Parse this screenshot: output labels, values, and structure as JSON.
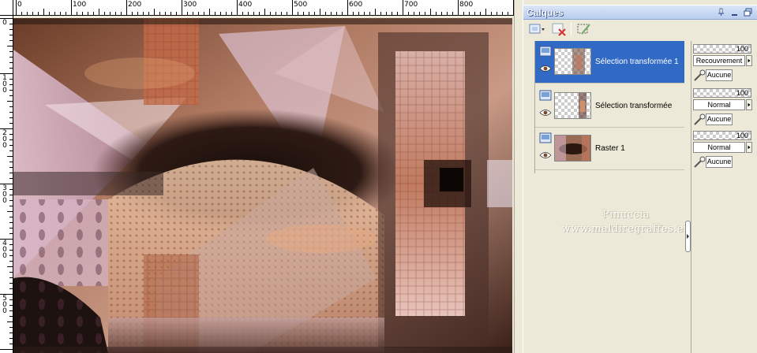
{
  "rulers": {
    "horizontal_labels": [
      "0",
      "100",
      "200",
      "300",
      "400",
      "500",
      "600",
      "700",
      "800"
    ],
    "vertical_labels": [
      "0",
      "1\n0\n0",
      "2\n0\n0",
      "3\n0\n0",
      "4\n0\n0",
      "5\n0\n0"
    ]
  },
  "canvas": {
    "colors": {
      "bg": "#a07560",
      "dark": "#2a1a14",
      "copper": "#c06a48",
      "pink": "#d4b0c4",
      "peach": "#e8b898",
      "mauve": "#b89aa8",
      "light": "#f4e2dc"
    }
  },
  "layers_panel": {
    "title": "Calques",
    "title_buttons": [
      "pin-icon",
      "minimize-icon",
      "restore-icon"
    ],
    "toolbar_icons": [
      "new-layer-icon",
      "delete-layer-icon",
      "mask-selection-icon"
    ],
    "layers": [
      {
        "name": "Sélection transformée 1",
        "selected": true,
        "thumb": "checker-small"
      },
      {
        "name": "Sélection transformée",
        "selected": false,
        "thumb": "checker-small"
      },
      {
        "name": "Raster 1",
        "selected": false,
        "thumb": "art"
      }
    ],
    "properties": [
      {
        "opacity": "100",
        "opacity_value": 100,
        "blend_mode": "Recouvrement",
        "mask": "Aucune"
      },
      {
        "opacity": "100",
        "opacity_value": 100,
        "blend_mode": "Normal",
        "mask": "Aucune"
      },
      {
        "opacity": "100",
        "opacity_value": 100,
        "blend_mode": "Normal",
        "mask": "Aucune"
      }
    ],
    "watermark_line1": "Pinuccia",
    "watermark_line2": "www.maldiregraffes.eu",
    "accent": "#316ac5"
  }
}
